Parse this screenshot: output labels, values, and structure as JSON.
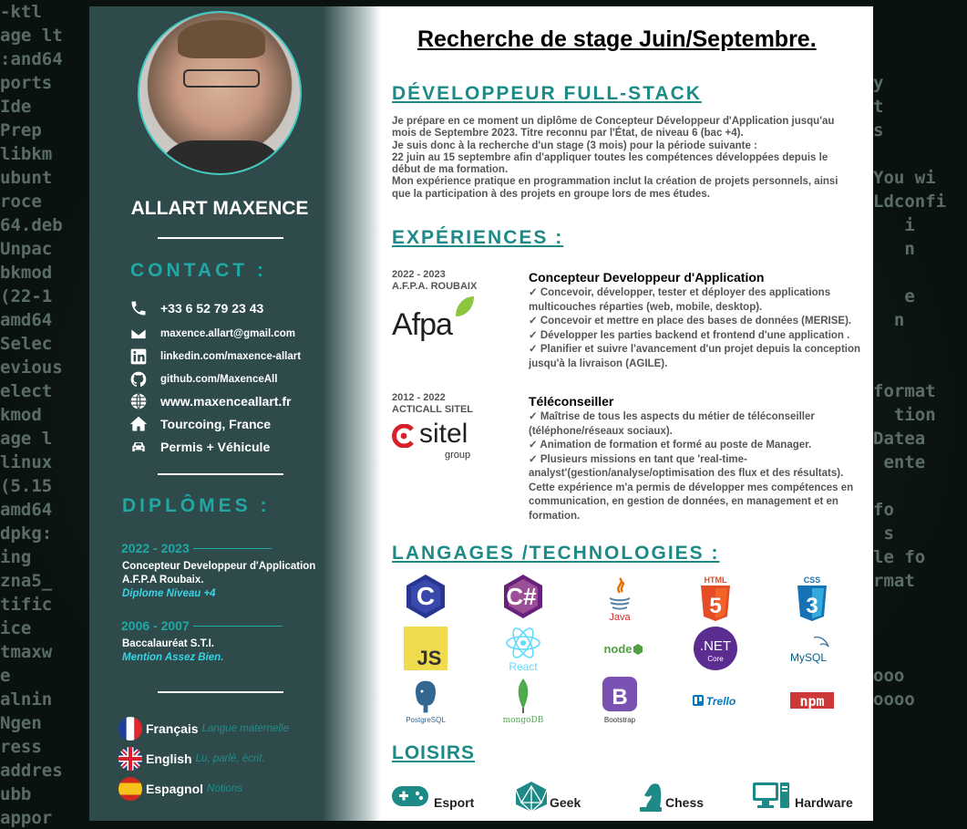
{
  "profile": {
    "name": "ALLART MAXENCE"
  },
  "contact": {
    "title": "CONTACT :",
    "items": [
      {
        "icon": "phone-icon",
        "text": "+33 6 52 79 23 43"
      },
      {
        "icon": "mail-icon",
        "text": "maxence.allart@gmail.com"
      },
      {
        "icon": "linkedin-icon",
        "text": "linkedin.com/maxence-allart"
      },
      {
        "icon": "github-icon",
        "text": "github.com/MaxenceAll"
      },
      {
        "icon": "globe-icon",
        "text": "www.maxenceallart.fr"
      },
      {
        "icon": "home-icon",
        "text": "Tourcoing, France"
      },
      {
        "icon": "car-icon",
        "text": "Permis + Véhicule"
      }
    ]
  },
  "diplomas": {
    "title": "DIPLÔMES :",
    "items": [
      {
        "year": "2022 - 2023",
        "name": "Concepteur Developpeur d'Application",
        "school": "A.F.P.A Roubaix.",
        "note": "Diplome Niveau +4"
      },
      {
        "year": "2006 - 2007",
        "name": "Baccalauréat S.T.I.",
        "note": "Mention Assez Bien."
      }
    ]
  },
  "languages": [
    {
      "flag": "france-flag-icon",
      "name": "Français",
      "level": "Langue maternelle"
    },
    {
      "flag": "uk-flag-icon",
      "name": "English",
      "level": "Lu, parlé, écrit."
    },
    {
      "flag": "spain-flag-icon",
      "name": "Espagnol",
      "level": "Notions"
    }
  ],
  "main": {
    "headline": "Recherche de stage Juin/Septembre.",
    "role_title": "DÉVELOPPEUR FULL-STACK",
    "intro": [
      "Je prépare en ce moment un diplôme de Concepteur Développeur d'Application jusqu'au mois de Septembre 2023. Titre reconnu par l'État, de niveau 6 (bac +4).",
      "Je suis donc à la recherche d'un stage (3 mois) pour la période suivante :",
      "22 juin au 15 septembre afin d'appliquer toutes les compétences développées depuis le début de ma formation.",
      "Mon expérience pratique en programmation inclut la création de projets personnels, ainsi que la participation à des projets en groupe lors de mes études."
    ],
    "experiences_title": "EXPÉRIENCES :",
    "experiences": [
      {
        "years": "2022 - 2023",
        "company": "A.F.P.A. ROUBAIX",
        "logo_text": "Afpa",
        "title": "Concepteur Developpeur d'Application",
        "points": [
          "✓ Concevoir, développer, tester et déployer des applications multicouches réparties (web, mobile, desktop).",
          "✓ Concevoir et mettre en place des bases de données (MERISE).",
          "✓ Développer les parties backend et frontend d'une application .",
          "✓ Planifier et suivre l'avancement d'un projet depuis la conception jusqu'à la livraison (AGILE)."
        ]
      },
      {
        "years": "2012 - 2022",
        "company": "ACTICALL SITEL",
        "logo_text": "sitel",
        "logo_sub": "group",
        "title": "Téléconseiller",
        "points": [
          "✓ Maîtrise de tous les aspects du métier de téléconseiller (téléphone/réseaux sociaux).",
          "✓ Animation de formation et formé au poste de Manager.",
          "✓ Plusieurs missions en tant que 'real-time-analyst'(gestion/analyse/optimisation des flux et des résultats). Cette expérience m'a permis de développer mes compétences en communication, en gestion de données, en management et en formation."
        ]
      }
    ],
    "tech_title": "LANGAGES /TECHNOLOGIES :",
    "tech": [
      {
        "icon": "c-icon",
        "label": "C"
      },
      {
        "icon": "csharp-icon",
        "label": "C#"
      },
      {
        "icon": "java-icon",
        "label": "Java"
      },
      {
        "icon": "html5-icon",
        "label": "HTML"
      },
      {
        "icon": "css3-icon",
        "label": "CSS"
      },
      {
        "icon": "javascript-icon",
        "label": "JS"
      },
      {
        "icon": "react-icon",
        "label": "React"
      },
      {
        "icon": "nodejs-icon",
        "label": "node"
      },
      {
        "icon": "dotnet-core-icon",
        "label": ".NET",
        "sub": "Core"
      },
      {
        "icon": "mysql-icon",
        "label": "MySQL"
      },
      {
        "icon": "postgresql-icon",
        "label": "PostgreSQL"
      },
      {
        "icon": "mongodb-icon",
        "label": "mongoDB"
      },
      {
        "icon": "bootstrap-icon",
        "label": "B",
        "sub": "Bootstrap"
      },
      {
        "icon": "trello-icon",
        "label": "Trello"
      },
      {
        "icon": "npm-icon",
        "label": "npm"
      }
    ],
    "hobbies_title": "LOISIRS",
    "hobbies": [
      {
        "icon": "gamepad-icon",
        "label": "Esport"
      },
      {
        "icon": "d20-icon",
        "label": "Geek"
      },
      {
        "icon": "chess-knight-icon",
        "label": "Chess"
      },
      {
        "icon": "computer-icon",
        "label": "Hardware"
      }
    ]
  },
  "colors": {
    "sidebar": "#2e4a4b",
    "accent": "#1fa8a4",
    "heading": "#1d8a88",
    "note": "#38d4e6"
  }
}
